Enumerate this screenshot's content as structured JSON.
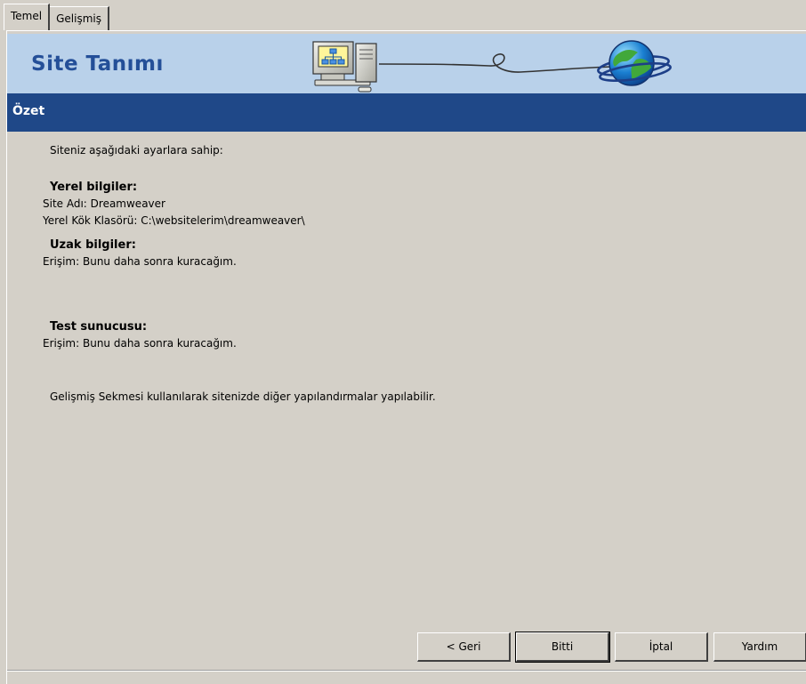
{
  "tabs": [
    {
      "label": "Temel",
      "active": true
    },
    {
      "label": "Gelişmiş",
      "active": false
    }
  ],
  "banner": {
    "title": "Site Tanımı",
    "icons": [
      "computer-icon",
      "globe-icon"
    ]
  },
  "section": {
    "title": "Özet"
  },
  "summary": {
    "intro": "Siteniz aşağıdaki ayarlara sahip:",
    "local": {
      "heading": "Yerel bilgiler:",
      "site_name": "Site Adı: Dreamweaver",
      "root_folder": "Yerel Kök Klasörü: C:\\websitelerim\\dreamweaver\\"
    },
    "remote": {
      "heading": "Uzak bilgiler:",
      "access": "Erişim: Bunu daha sonra kuracağım."
    },
    "testing": {
      "heading": "Test sunucusu:",
      "access": "Erişim: Bunu daha sonra kuracağım."
    },
    "note": "Gelişmiş Sekmesi kullanılarak sitenizde diğer yapılandırmalar yapılabilir."
  },
  "buttons": {
    "back": "< Geri",
    "finish": "Bitti",
    "cancel": "İptal",
    "help": "Yardım"
  },
  "colors": {
    "window_bg": "#d4d0c8",
    "banner_bg": "#b9d1ea",
    "banner_title": "#244f98",
    "section_bar": "#1f4888"
  }
}
